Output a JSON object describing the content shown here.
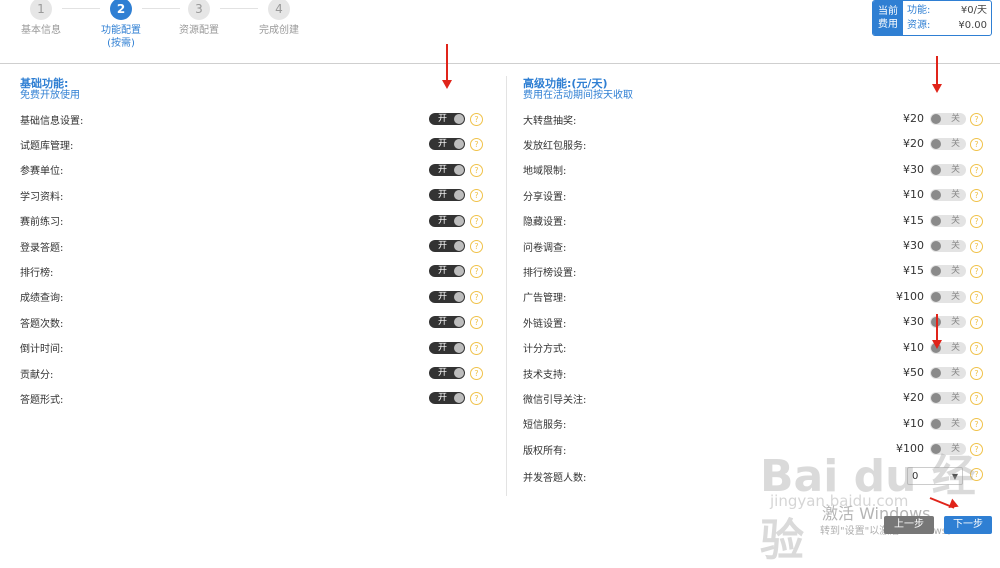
{
  "steps": [
    {
      "num": "1",
      "label": "基本信息",
      "active": false
    },
    {
      "num": "2",
      "label": "功能配置",
      "label2": "(按需)",
      "active": true
    },
    {
      "num": "3",
      "label": "资源配置",
      "active": false
    },
    {
      "num": "4",
      "label": "完成创建",
      "active": false
    }
  ],
  "cost": {
    "tag_line1": "当前",
    "tag_line2": "费用",
    "function_label": "功能:",
    "function_value": "¥0/天",
    "resource_label": "资源:",
    "resource_value": "¥0.00"
  },
  "basic": {
    "title": "基础功能:",
    "subtitle": "免费开放使用",
    "items": [
      {
        "name": "基础信息设置:",
        "toggle": "开"
      },
      {
        "name": "试题库管理:",
        "toggle": "开"
      },
      {
        "name": "参赛单位:",
        "toggle": "开"
      },
      {
        "name": "学习资料:",
        "toggle": "开"
      },
      {
        "name": "赛前练习:",
        "toggle": "开"
      },
      {
        "name": "登录答题:",
        "toggle": "开"
      },
      {
        "name": "排行榜:",
        "toggle": "开"
      },
      {
        "name": "成绩查询:",
        "toggle": "开"
      },
      {
        "name": "答题次数:",
        "toggle": "开"
      },
      {
        "name": "倒计时间:",
        "toggle": "开"
      },
      {
        "name": "贡献分:",
        "toggle": "开"
      },
      {
        "name": "答题形式:",
        "toggle": "开"
      }
    ]
  },
  "advanced": {
    "title": "高级功能:(元/天)",
    "subtitle": "费用在活动期间按天收取",
    "items": [
      {
        "name": "大转盘抽奖:",
        "price": "¥20",
        "toggle": "关"
      },
      {
        "name": "发放红包服务:",
        "price": "¥20",
        "toggle": "关"
      },
      {
        "name": "地域限制:",
        "price": "¥30",
        "toggle": "关"
      },
      {
        "name": "分享设置:",
        "price": "¥10",
        "toggle": "关"
      },
      {
        "name": "隐藏设置:",
        "price": "¥15",
        "toggle": "关"
      },
      {
        "name": "问卷调查:",
        "price": "¥30",
        "toggle": "关"
      },
      {
        "name": "排行榜设置:",
        "price": "¥15",
        "toggle": "关"
      },
      {
        "name": "广告管理:",
        "price": "¥100",
        "toggle": "关"
      },
      {
        "name": "外链设置:",
        "price": "¥30",
        "toggle": "关"
      },
      {
        "name": "计分方式:",
        "price": "¥10",
        "toggle": "关"
      },
      {
        "name": "技术支持:",
        "price": "¥50",
        "toggle": "关"
      },
      {
        "name": "微信引导关注:",
        "price": "¥20",
        "toggle": "关"
      },
      {
        "name": "短信服务:",
        "price": "¥10",
        "toggle": "关"
      },
      {
        "name": "版权所有:",
        "price": "¥100",
        "toggle": "关"
      }
    ],
    "concurrent_label": "并发答题人数:",
    "concurrent_value": "0"
  },
  "buttons": {
    "prev": "上一步",
    "next": "下一步"
  },
  "watermark": {
    "baidu": "Bai du 经验",
    "jingyan": "jingyan.baidu.com",
    "activate": "激活 Windows",
    "activate_sub": "转到\"设置\"以激活 Windows。"
  },
  "colors": {
    "accent": "#2f7fd3",
    "arrow": "#e0241a",
    "help": "#f0c24a"
  }
}
